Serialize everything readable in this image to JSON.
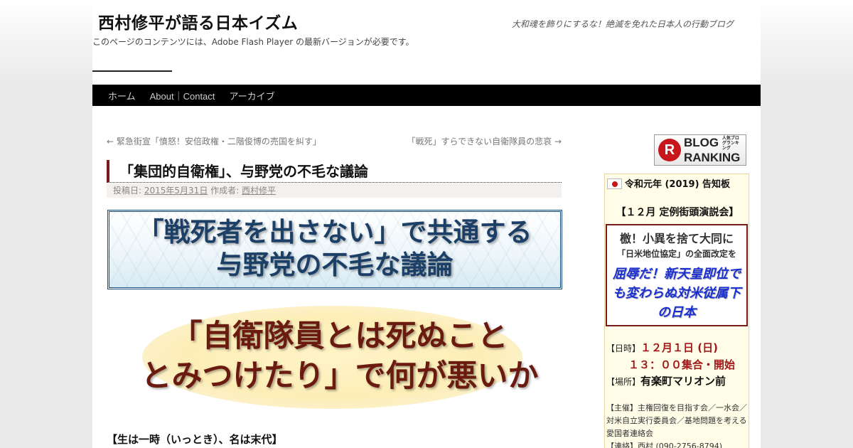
{
  "site": {
    "title": "西村修平が語る日本イズム",
    "description": "大和魂を飾りにするな！絶滅を免れた日本人の行動ブログ",
    "flash_note": "このページのコンテンツには、Adobe Flash Player の最新バージョンが必要です。"
  },
  "nav": {
    "items": [
      "ホーム",
      "About｜Contact",
      "アーカイブ"
    ]
  },
  "post_nav": {
    "prev": "← 緊急街宣「憤怒！安倍政権・二階俊博の売国を糾す」",
    "next": "「戦死」すらできない自衛隊員の悲哀 →"
  },
  "post": {
    "title": "「集団的自衛権」、与野党の不毛な議論",
    "meta": {
      "posted_label": "投稿日:",
      "date": "2015年5月31日",
      "author_label": "作成者:",
      "author": "西村修平"
    },
    "banner1": {
      "line1": "「戦死者を出さない」で共通する",
      "line2": "与野党の不毛な議論"
    },
    "banner2": {
      "line1": "「自衛隊員とは死ぬこと",
      "line2": "とみつけたり」で何が悪いか"
    },
    "subhead": "【生は一時（いっとき）、名は末代】"
  },
  "sidebar": {
    "ranking": {
      "mark": "R",
      "small": "人気ブログランキング",
      "line1": "BLOG",
      "line2": "RANKING"
    },
    "notice": {
      "title": "令和元年 (2019) 告知板",
      "subtitle": "【１２月 定例街頭演説会】",
      "box": {
        "line1": "檄！小異を捨て大同に",
        "line2": "「日米地位協定」の全面改定を",
        "line3": "屈辱だ！新天皇即位でも変わらぬ対米従属下の日本"
      },
      "date_label": "【日時】",
      "date_value": "１２月１日 (日)",
      "time_value": "１３：００集合・開始",
      "place_label": "【場所】",
      "place_value": "有楽町マリオン前",
      "organizer": "【主催】主権回復を目指す会／一水会／対米自立実行委員会／基地問題を考える愛国者連絡会",
      "contact": "【連絡】西村 (090-2756-8794)"
    }
  },
  "colors": {
    "nav_bg": "#000000",
    "accent_bar": "#7a1b1b",
    "banner1_text": "#1b3f66",
    "banner2_text": "#6b1a10",
    "notice_link": "#1a2fd1",
    "date_red": "#a01818"
  }
}
